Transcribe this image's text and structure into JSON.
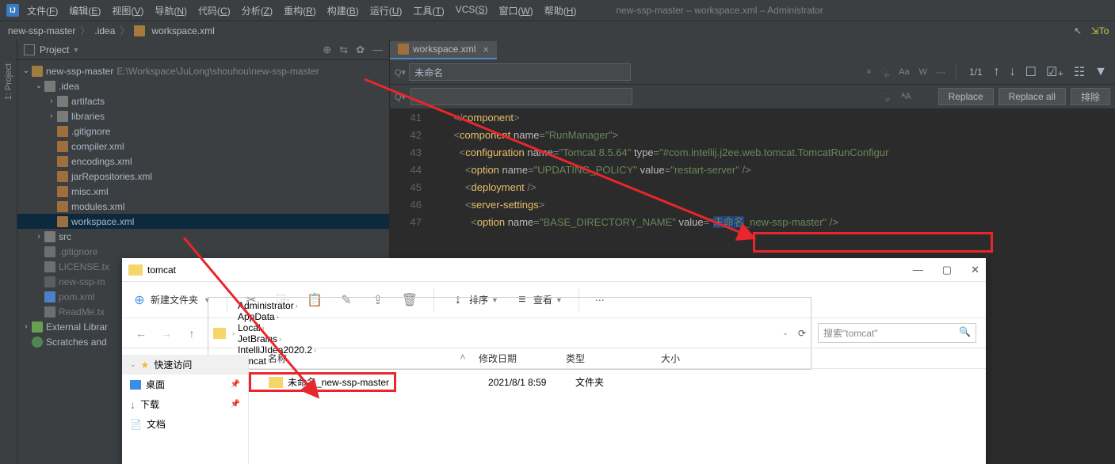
{
  "titlebar": {
    "logo": "IJ",
    "menus": [
      "文件(F)",
      "编辑(E)",
      "视图(V)",
      "导航(N)",
      "代码(C)",
      "分析(Z)",
      "重构(R)",
      "构建(B)",
      "运行(U)",
      "工具(T)",
      "VCS(S)",
      "窗口(W)",
      "帮助(H)"
    ],
    "window_title": "new-ssp-master – workspace.xml – Administrator"
  },
  "breadcrumb": {
    "parts": [
      "new-ssp-master",
      ".idea",
      "workspace.xml"
    ]
  },
  "toolbar": {
    "to_label": "To"
  },
  "gutter": {
    "project": "1: Project"
  },
  "project_panel": {
    "title": "Project",
    "root": {
      "name": "new-ssp-master",
      "path": "E:\\Workspace\\JuLong\\shouhou\\new-ssp-master"
    },
    "idea_folder": ".idea",
    "artifacts": "artifacts",
    "libraries": "libraries",
    "files": [
      ".gitignore",
      "compiler.xml",
      "encodings.xml",
      "jarRepositories.xml",
      "misc.xml",
      "modules.xml",
      "workspace.xml"
    ],
    "src": "src",
    "root_files": [
      ".gitignore",
      "LICENSE.tx",
      "new-ssp-m",
      "pom.xml",
      "ReadMe.tx"
    ],
    "external_libs": "External Librar",
    "scratches": "Scratches and"
  },
  "tab": {
    "name": "workspace.xml"
  },
  "find": {
    "value": "未命名",
    "replace_placeholder": "Q-",
    "count": "1/1",
    "replace_btn": "Replace",
    "replace_all_btn": "Replace all",
    "exclude_btn": "排除"
  },
  "code": {
    "lines": [
      {
        "n": "41",
        "html": "    </component>"
      },
      {
        "n": "42",
        "html": "    <component name=\"RunManager\">"
      },
      {
        "n": "43",
        "html": "      <configuration name=\"Tomcat 8.5.64\" type=\"#com.intellij.j2ee.web.tomcat.TomcatRunConfigur"
      },
      {
        "n": "44",
        "html": "        <option name=\"UPDATING_POLICY\" value=\"restart-server\" />"
      },
      {
        "n": "45",
        "html": "        <deployment />"
      },
      {
        "n": "46",
        "html": "        <server-settings>"
      },
      {
        "n": "47",
        "html": "          <option name=\"BASE_DIRECTORY_NAME\" value=\"未命名_new-ssp-master\" />"
      }
    ]
  },
  "explorer": {
    "title": "tomcat",
    "new_folder": "新建文件夹",
    "sort": "排序",
    "view": "查看",
    "path": [
      "Administrator",
      "AppData",
      "Local",
      "JetBrains",
      "IntelliJIdea2020.2",
      "tomcat"
    ],
    "search_placeholder": "搜索\"tomcat\"",
    "headers": {
      "name": "名称",
      "date": "修改日期",
      "type": "类型",
      "size": "大小"
    },
    "quick": "快速访问",
    "desktop": "桌面",
    "downloads": "下载",
    "docs": "文档",
    "file": {
      "name": "未命名_new-ssp-master",
      "date": "2021/8/1 8:59",
      "type": "文件夹"
    }
  }
}
